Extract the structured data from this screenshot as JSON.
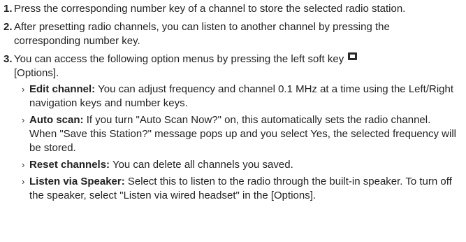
{
  "steps": [
    {
      "number": "1.",
      "text": "Press the corresponding number key of a channel to store the selected radio station."
    },
    {
      "number": "2.",
      "text": "After presetting radio channels, you can listen to another channel by pressing the corresponding number key."
    },
    {
      "number": "3.",
      "text_before_icon": "You can access the following option menus by pressing the left soft key",
      "icon": "left-soft-key-icon",
      "text_after_icon": "[Options].",
      "options": [
        {
          "term": "Edit channel:",
          "description": "You can adjust frequency and channel 0.1 MHz at a time using the Left/Right navigation keys and number keys."
        },
        {
          "term": "Auto scan:",
          "description": "If you turn \"Auto Scan Now?\" on, this automatically sets the radio channel. When \"Save this Station?\" message pops up and you select Yes, the selected frequency will be stored."
        },
        {
          "term": "Reset channels:",
          "description": "You can delete all channels you saved."
        },
        {
          "term": "Listen via Speaker:",
          "description": "Select this to listen to the radio through the built-in speaker. To turn off the speaker, select \"Listen via wired headset\" in the [Options]."
        }
      ]
    }
  ],
  "bullet_glyph": "›"
}
